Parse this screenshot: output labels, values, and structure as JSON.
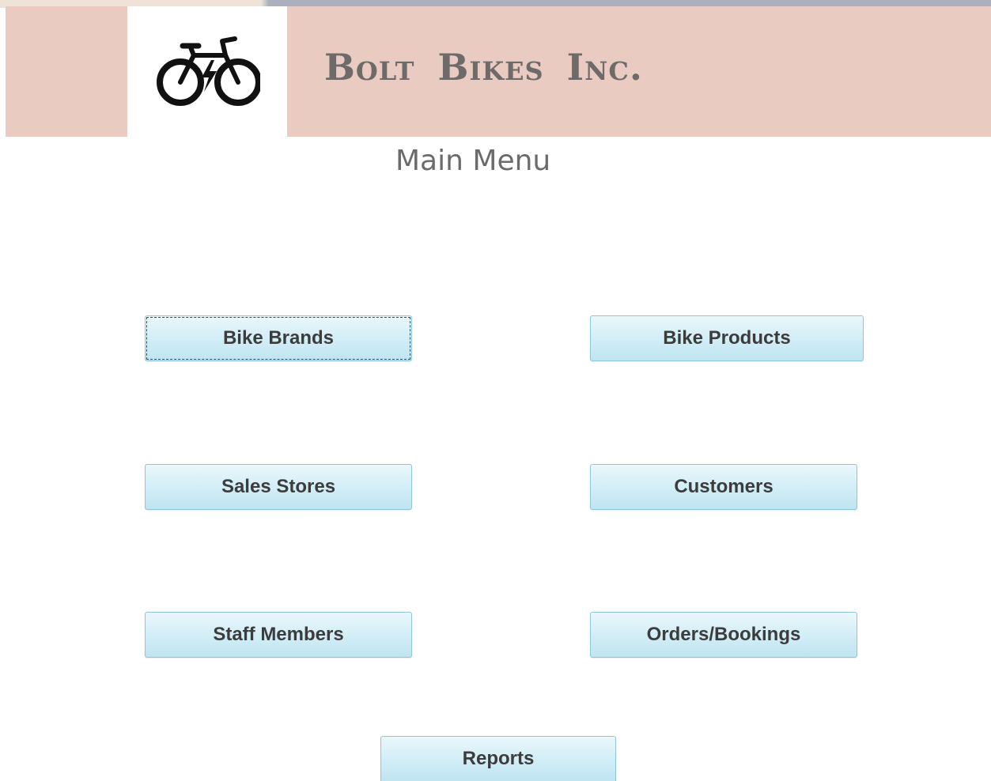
{
  "header": {
    "company_name": "Bolt Bikes Inc.",
    "logo_icon": "electric-bicycle-icon",
    "background_color": "#eacbc1"
  },
  "page_title": "Main Menu",
  "menu": {
    "bike_brands": "Bike Brands",
    "bike_products": "Bike Products",
    "sales_stores": "Sales Stores",
    "customers": "Customers",
    "staff_members": "Staff Members",
    "orders_bookings": "Orders/Bookings",
    "reports": "Reports"
  },
  "colors": {
    "button_gradient_top": "#eaf7fb",
    "button_gradient_bottom": "#bfe5f1",
    "button_border": "#8fc7d9",
    "text_gray": "#6b6b6b"
  }
}
